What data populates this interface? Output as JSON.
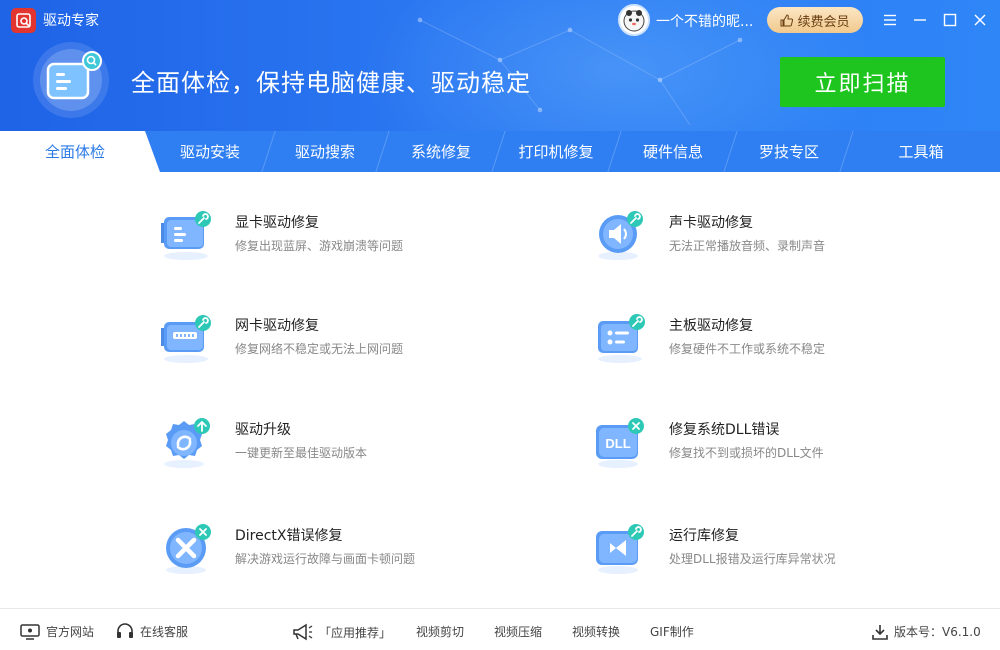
{
  "app": {
    "title": "驱动专家"
  },
  "user": {
    "name": "一个不错的昵...",
    "renew_label": "续费会员"
  },
  "hero": {
    "tagline": "全面体检，保持电脑健康、驱动稳定",
    "scan_label": "立即扫描"
  },
  "tabs": [
    {
      "label": "全面体检"
    },
    {
      "label": "驱动安装"
    },
    {
      "label": "驱动搜索"
    },
    {
      "label": "系统修复"
    },
    {
      "label": "打印机修复"
    },
    {
      "label": "硬件信息"
    },
    {
      "label": "罗技专区"
    },
    {
      "label": "工具箱"
    }
  ],
  "items": [
    {
      "title": "显卡驱动修复",
      "desc": "修复出现蓝屏、游戏崩溃等问题",
      "icon": "gpu-repair-icon"
    },
    {
      "title": "声卡驱动修复",
      "desc": "无法正常播放音频、录制声音",
      "icon": "audio-repair-icon"
    },
    {
      "title": "网卡驱动修复",
      "desc": "修复网络不稳定或无法上网问题",
      "icon": "network-repair-icon"
    },
    {
      "title": "主板驱动修复",
      "desc": "修复硬件不工作或系统不稳定",
      "icon": "motherboard-repair-icon"
    },
    {
      "title": "驱动升级",
      "desc": "一键更新至最佳驱动版本",
      "icon": "driver-upgrade-icon"
    },
    {
      "title": "修复系统DLL错误",
      "desc": "修复找不到或损坏的DLL文件",
      "icon": "dll-repair-icon"
    },
    {
      "title": "DirectX错误修复",
      "desc": "解决游戏运行故障与画面卡顿问题",
      "icon": "directx-repair-icon"
    },
    {
      "title": "运行库修复",
      "desc": "处理DLL报错及运行库异常状况",
      "icon": "runtime-repair-icon"
    }
  ],
  "footer": {
    "website": "官方网站",
    "support": "在线客服",
    "recommend": "「应用推荐」",
    "video_cut": "视频剪切",
    "video_compress": "视频压缩",
    "video_convert": "视频转换",
    "gif": "GIF制作",
    "version": "版本号：V6.1.0"
  },
  "colors": {
    "header": "#2b78f2",
    "tabbar": "#2f7ff2",
    "scan": "#1ec51e",
    "accent": "#2b7ae6"
  }
}
